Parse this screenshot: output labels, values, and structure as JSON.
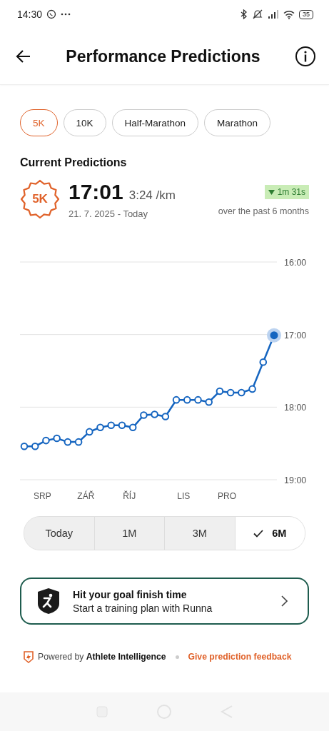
{
  "status_bar": {
    "time": "14:30",
    "battery": "35"
  },
  "header": {
    "title": "Performance Predictions"
  },
  "distance_chips": [
    {
      "label": "5K",
      "selected": true
    },
    {
      "label": "10K",
      "selected": false
    },
    {
      "label": "Half-Marathon",
      "selected": false
    },
    {
      "label": "Marathon",
      "selected": false
    }
  ],
  "section_title": "Current Predictions",
  "prediction": {
    "badge": "5K",
    "time": "17:01",
    "pace": "3:24 /km",
    "range": "21. 7. 2025 - Today",
    "change": "1m 31s",
    "change_note": "over the past 6 months"
  },
  "chart": {
    "chart_data": {
      "type": "line",
      "categories": [
        null,
        null,
        "SRP",
        null,
        null,
        null,
        "ZÁŘ",
        null,
        null,
        null,
        "ŘÍJ",
        null,
        null,
        null,
        null,
        "LIS",
        null,
        null,
        null,
        "PRO",
        null,
        null,
        null,
        null
      ],
      "series": [
        {
          "color": "#1565c0",
          "marker": "circle",
          "values": [
            18.54,
            18.54,
            18.46,
            18.43,
            18.48,
            18.48,
            18.34,
            18.28,
            18.25,
            18.25,
            18.28,
            18.11,
            18.1,
            18.13,
            17.9,
            17.9,
            17.9,
            17.93,
            17.78,
            17.8,
            17.8,
            17.75,
            17.38,
            17.01
          ]
        }
      ],
      "ylim": [
        19,
        16
      ],
      "yticks": [
        {
          "value": 16,
          "label": "16:00"
        },
        {
          "value": 17,
          "label": "17:00"
        },
        {
          "value": 18,
          "label": "18:00"
        },
        {
          "value": 19,
          "label": "19:00"
        }
      ]
    }
  },
  "ranges": [
    {
      "label": "Today",
      "selected": false
    },
    {
      "label": "1M",
      "selected": false
    },
    {
      "label": "3M",
      "selected": false
    },
    {
      "label": "6M",
      "selected": true
    }
  ],
  "promo": {
    "title": "Hit your goal finish time",
    "subtitle": "Start a training plan with Runna"
  },
  "footer": {
    "powered": "Powered by **Athlete Intelligence**",
    "link": "Give prediction feedback"
  }
}
